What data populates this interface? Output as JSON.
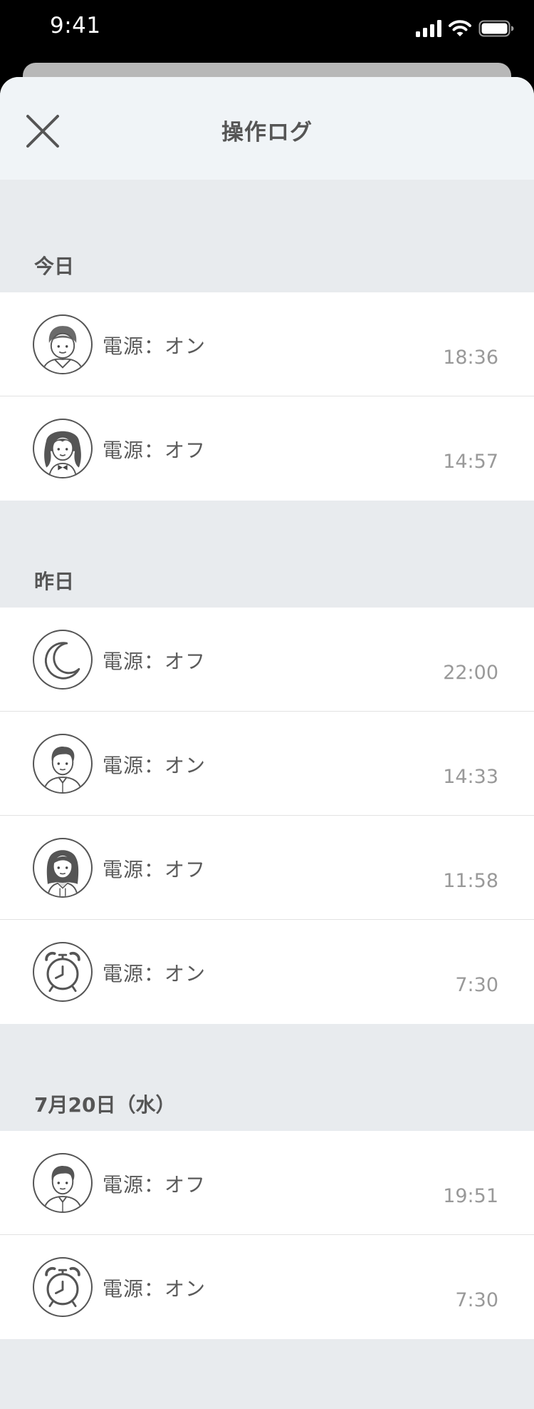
{
  "status_bar": {
    "time": "9:41"
  },
  "nav": {
    "title": "操作ログ",
    "close_icon": "close-icon"
  },
  "sections": [
    {
      "title": "今日",
      "items": [
        {
          "avatar": "boy-avatar-icon",
          "label": "電源：オン",
          "time": "18:36"
        },
        {
          "avatar": "girl-long-hair-avatar-icon",
          "label": "電源：オフ",
          "time": "14:57"
        }
      ]
    },
    {
      "title": "昨日",
      "items": [
        {
          "avatar": "moon-icon",
          "label": "電源：オフ",
          "time": "22:00"
        },
        {
          "avatar": "man-avatar-icon",
          "label": "電源：オン",
          "time": "14:33"
        },
        {
          "avatar": "woman-avatar-icon",
          "label": "電源：オフ",
          "time": "11:58"
        },
        {
          "avatar": "alarm-clock-icon",
          "label": "電源：オン",
          "time": "7:30"
        }
      ]
    },
    {
      "title": "7月20日（水）",
      "items": [
        {
          "avatar": "man-avatar-icon",
          "label": "電源：オフ",
          "time": "19:51"
        },
        {
          "avatar": "alarm-clock-icon",
          "label": "電源：オン",
          "time": "7:30"
        }
      ]
    }
  ]
}
